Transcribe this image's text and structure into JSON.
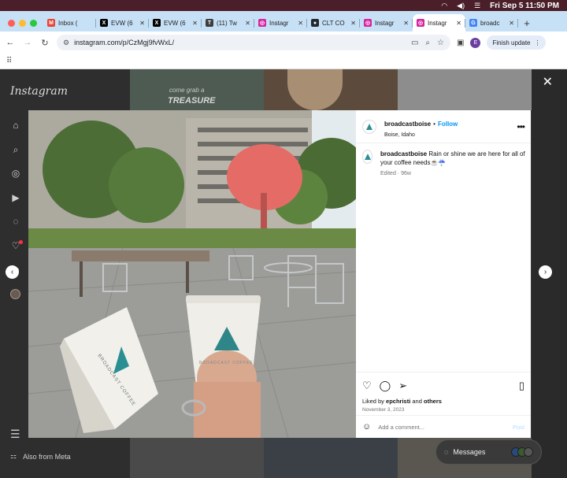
{
  "menubar": {
    "datetime": "Fri Sep 5  11:50 PM"
  },
  "tabs": [
    {
      "label": "Inbox (",
      "favicon": "gmail-icon",
      "color": "#ea4335",
      "glyph": "M",
      "active": false
    },
    {
      "label": "EVW (6",
      "favicon": "x-icon",
      "color": "#000000",
      "glyph": "X",
      "active": false
    },
    {
      "label": "EVW (6",
      "favicon": "x-icon",
      "color": "#000000",
      "glyph": "X",
      "active": false
    },
    {
      "label": "(11) Tw",
      "favicon": "tweetdeck-icon",
      "color": "#3d3d3d",
      "glyph": "T",
      "active": false
    },
    {
      "label": "Instagr",
      "favicon": "instagram-icon",
      "color": "#d6249f",
      "glyph": "◎",
      "active": false
    },
    {
      "label": "CLT CO",
      "favicon": "github-icon",
      "color": "#24292e",
      "glyph": "●",
      "active": false
    },
    {
      "label": "Instagr",
      "favicon": "instagram-icon",
      "color": "#d6249f",
      "glyph": "◎",
      "active": false
    },
    {
      "label": "Instagr",
      "favicon": "instagram-icon",
      "color": "#d6249f",
      "glyph": "◎",
      "active": true
    },
    {
      "label": "broadc",
      "favicon": "google-icon",
      "color": "#4285f4",
      "glyph": "G",
      "active": false
    }
  ],
  "toolbar": {
    "url": "instagram.com/p/CzMgj9fvWxL/",
    "profile_initial": "E",
    "finish_update": "Finish update"
  },
  "sidebar": {
    "logo": "Instagram",
    "also_from_meta": "Also from Meta"
  },
  "post": {
    "username": "broadcastboise",
    "follow": "Follow",
    "location": "Boise, Idaho",
    "caption": "Rain or shine we are here for all of your coffee needs☕️☔️",
    "edited": "Edited",
    "age": "96w",
    "liked_prefix": "Liked by ",
    "liked_user": "epchristi",
    "liked_and": " and ",
    "liked_others": "others",
    "date": "November 3, 2023",
    "comment_placeholder": "Add a comment...",
    "post_button": "Post"
  },
  "photo": {
    "sign_text": "BROADCAST COFFEE",
    "cup_text": "BROADCAST COFFEE"
  },
  "background": {
    "tile_text": "come grab a",
    "tile_text_2": "TREASURE"
  },
  "messages": {
    "label": "Messages"
  }
}
